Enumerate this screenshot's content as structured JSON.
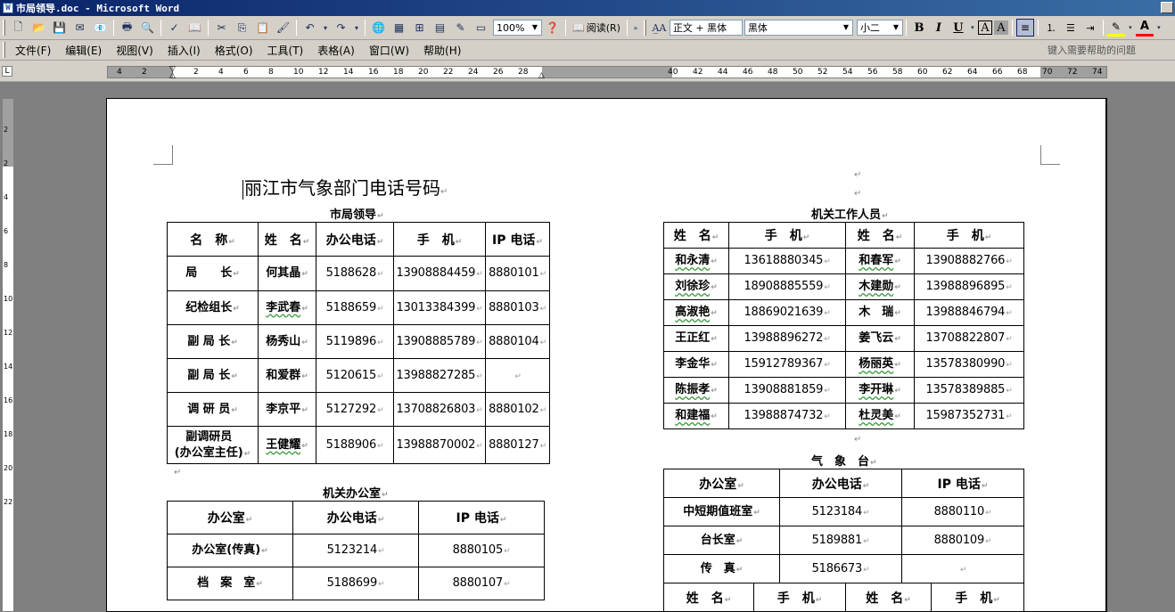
{
  "window": {
    "title": "市局领导.doc - Microsoft Word"
  },
  "toolbar": {
    "zoom": "100%",
    "read_label": "阅读(R)",
    "style": "正文 + 黑体",
    "font": "黑体",
    "size": "小二",
    "bold": "B",
    "italic": "I",
    "underline": "U",
    "charborder": "A",
    "charshade": "A",
    "fontcolor": "A"
  },
  "menu": {
    "items": [
      "文件(F)",
      "编辑(E)",
      "视图(V)",
      "插入(I)",
      "格式(O)",
      "工具(T)",
      "表格(A)",
      "窗口(W)",
      "帮助(H)"
    ],
    "help_prompt": "键入需要帮助的问题"
  },
  "ruler": {
    "ticks": [
      "4",
      "2",
      "2",
      "4",
      "6",
      "8",
      "10",
      "12",
      "14",
      "16",
      "18",
      "20",
      "22",
      "24",
      "26",
      "28",
      "40",
      "42",
      "44",
      "46",
      "48",
      "50",
      "52",
      "54",
      "56",
      "58",
      "60",
      "62",
      "64",
      "66",
      "68",
      "70",
      "72",
      "74"
    ],
    "vticks": [
      "2",
      "2",
      "4",
      "6",
      "8",
      "10",
      "12",
      "14",
      "16",
      "18",
      "20",
      "22"
    ]
  },
  "doc": {
    "title": "丽江市气象部门电话号码",
    "leaders": {
      "title": "市局领导",
      "headers": [
        "名　称",
        "姓　名",
        "办公电话",
        "手　机",
        "IP 电话"
      ],
      "rows": [
        [
          "局　　长",
          "何其晶",
          "5188628",
          "13908884459",
          "8880101"
        ],
        [
          "纪检组长",
          "李武春",
          "5188659",
          "13013384399",
          "8880103"
        ],
        [
          "副 局 长",
          "杨秀山",
          "5119896",
          "13908885789",
          "8880104"
        ],
        [
          "副 局 长",
          "和爱群",
          "5120615",
          "13988827285",
          ""
        ],
        [
          "调 研 员",
          "李京平",
          "5127292",
          "13708826803",
          "8880102"
        ],
        [
          "副调研员\n(办公室主任)",
          "王健耀",
          "5188906",
          "13988870002",
          "8880127"
        ]
      ]
    },
    "office": {
      "title": "机关办公室",
      "headers": [
        "办公室",
        "办公电话",
        "IP 电话"
      ],
      "rows": [
        [
          "办公室(传真)",
          "5123214",
          "8880105"
        ],
        [
          "档　案　室",
          "5188699",
          "8880107"
        ]
      ]
    },
    "staff": {
      "title": "机关工作人员",
      "headers": [
        "姓　名",
        "手　机",
        "姓　名",
        "手　机"
      ],
      "rows": [
        [
          "和永清",
          "13618880345",
          "和春军",
          "13908882766"
        ],
        [
          "刘徐珍",
          "18908885559",
          "木建勋",
          "13988896895"
        ],
        [
          "高淑艳",
          "18869021639",
          "木　瑞",
          "13988846794"
        ],
        [
          "王正红",
          "13988896272",
          "姜飞云",
          "13708822807"
        ],
        [
          "李金华",
          "15912789367",
          "杨丽英",
          "13578380990"
        ],
        [
          "陈振孝",
          "13908881859",
          "李开琳",
          "13578389885"
        ],
        [
          "和建福",
          "13988874732",
          "杜灵美",
          "15987352731"
        ]
      ]
    },
    "observatory": {
      "title": "气　象　台",
      "headers": [
        "办公室",
        "办公电话",
        "IP 电话"
      ],
      "rows": [
        [
          "中短期值班室",
          "5123184",
          "8880110"
        ],
        [
          "台长室",
          "5189881",
          "8880109"
        ],
        [
          "传　真",
          "5186673",
          ""
        ]
      ],
      "headers2": [
        "姓　名",
        "手　机",
        "姓　名",
        "手　机"
      ]
    }
  }
}
